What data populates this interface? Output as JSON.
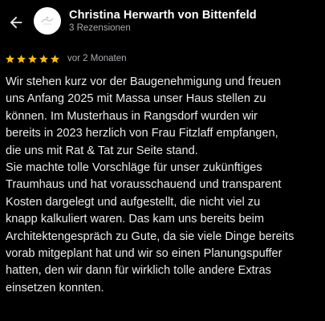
{
  "header": {
    "author_name": "Christina Herwarth von Bittenfeld",
    "review_count": "3 Rezensionen",
    "back_icon": "arrow-left-icon",
    "avatar_icon": "avatar"
  },
  "review": {
    "rating": 5,
    "rating_max": 5,
    "star_color": "#fbbc04",
    "date": "vor 2 Monaten",
    "text": "Wir stehen kurz vor der Baugenehmigung und freuen\nuns Anfang 2025 mit Massa unser Haus stellen zu\nkönnen. Im Musterhaus in Rangsdorf wurden wir\nbereits in 2023 herzlich von Frau Fitzlaff empfangen,\ndie uns mit Rat & Tat zur Seite stand.\nSie machte tolle Vorschläge für unser zukünftiges\nTraumhaus und hat vorausschauend und transparent\nKosten dargelegt und aufgestellt, die nicht viel zu\nknapp kalkuliert waren. Das kam uns bereits beim\nArchitektengespräch zu Gute, da sie viele Dinge bereits\nvorab mitgeplant hat und wir so einen Planungspuffer\nhatten, den wir dann für wirklich tolle andere Extras\neinsetzen konnten."
  }
}
